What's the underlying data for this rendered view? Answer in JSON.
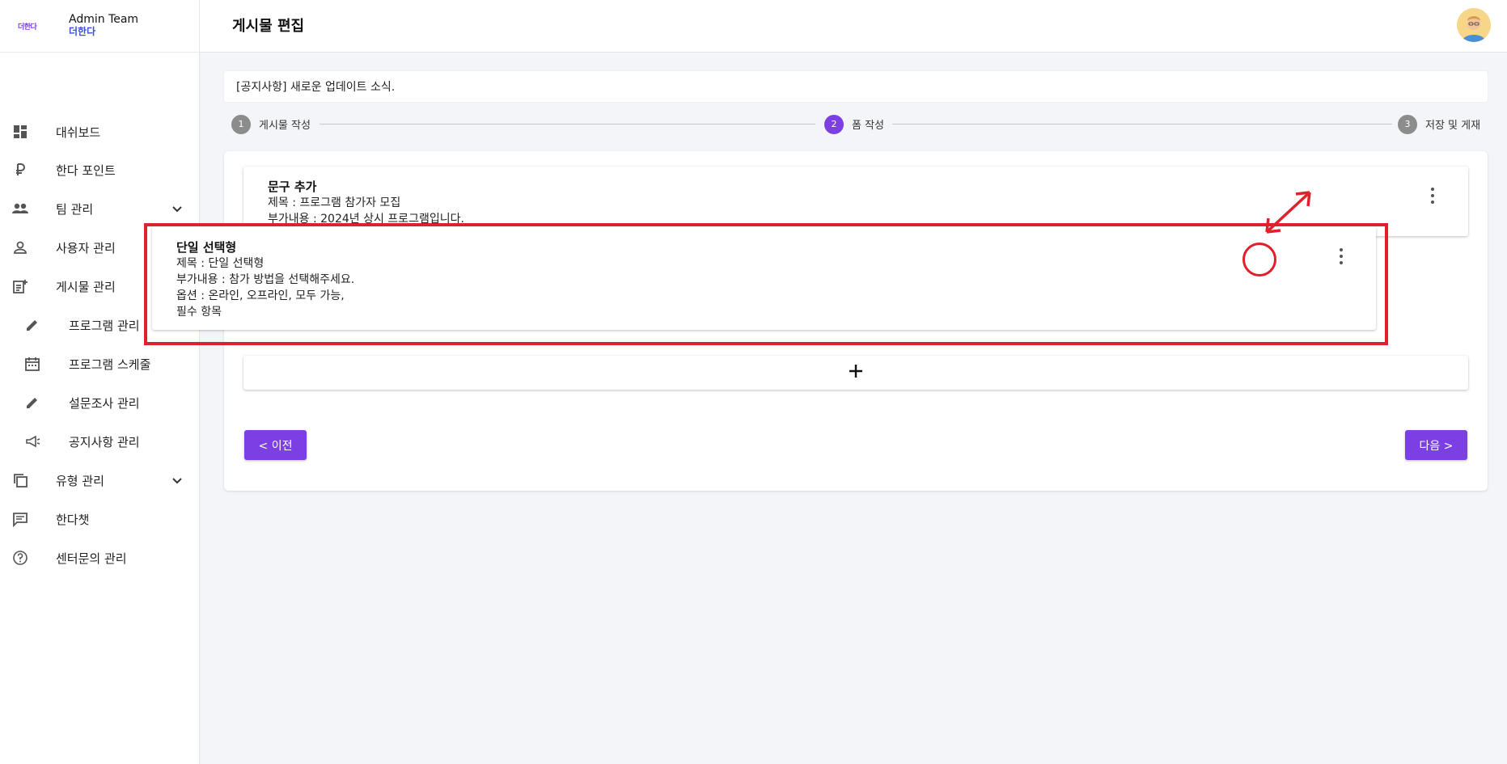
{
  "brand": {
    "logo_text": "더한다",
    "title": "Admin Team",
    "subtitle": "더한다"
  },
  "sidebar": {
    "items": [
      {
        "label": "대쉬보드",
        "icon": "dashboard-icon"
      },
      {
        "label": "한다 포인트",
        "icon": "ruble-icon"
      },
      {
        "label": "팀 관리",
        "icon": "group-icon",
        "expandable": true
      },
      {
        "label": "사용자 관리",
        "icon": "person-icon",
        "expandable": true
      },
      {
        "label": "게시물 관리",
        "icon": "post-add-icon"
      },
      {
        "label": "프로그램 관리",
        "icon": "pencil-icon",
        "sub": true
      },
      {
        "label": "프로그램 스케줄",
        "icon": "calendar-icon",
        "sub": true
      },
      {
        "label": "설문조사 관리",
        "icon": "pencil-icon",
        "sub": true
      },
      {
        "label": "공지사항 관리",
        "icon": "megaphone-icon",
        "sub": true
      },
      {
        "label": "유형 관리",
        "icon": "copy-icon",
        "expandable": true
      },
      {
        "label": "한다챗",
        "icon": "chat-icon"
      },
      {
        "label": "센터문의 관리",
        "icon": "help-icon"
      }
    ]
  },
  "header": {
    "title": "게시물 편집"
  },
  "notice": {
    "text": "[공지사항] 새로운 업데이트 소식."
  },
  "stepper": {
    "steps": [
      {
        "num": "1",
        "label": "게시물 작성",
        "active": false
      },
      {
        "num": "2",
        "label": "폼 작성",
        "active": true
      },
      {
        "num": "3",
        "label": "저장 및 게재",
        "active": false
      }
    ]
  },
  "items": {
    "phrase": {
      "title": "문구 추가",
      "line1": "제목 : 프로그램 참가자 모집",
      "line2": "부가내용 : 2024년 상시 프로그램입니다."
    },
    "single_choice": {
      "title": "단일 선택형",
      "line1": "제목 : 단일 선택형",
      "line2": "부가내용 : 참가 방법을 선택해주세요.",
      "line3": "옵션 : 온라인,  오프라인,  모두 가능,",
      "line4": "필수 항목"
    }
  },
  "buttons": {
    "prev": "< 이전",
    "next": "다음 >",
    "add": "+"
  },
  "colors": {
    "accent": "#7b3fe4",
    "annotation": "#e0202a"
  }
}
